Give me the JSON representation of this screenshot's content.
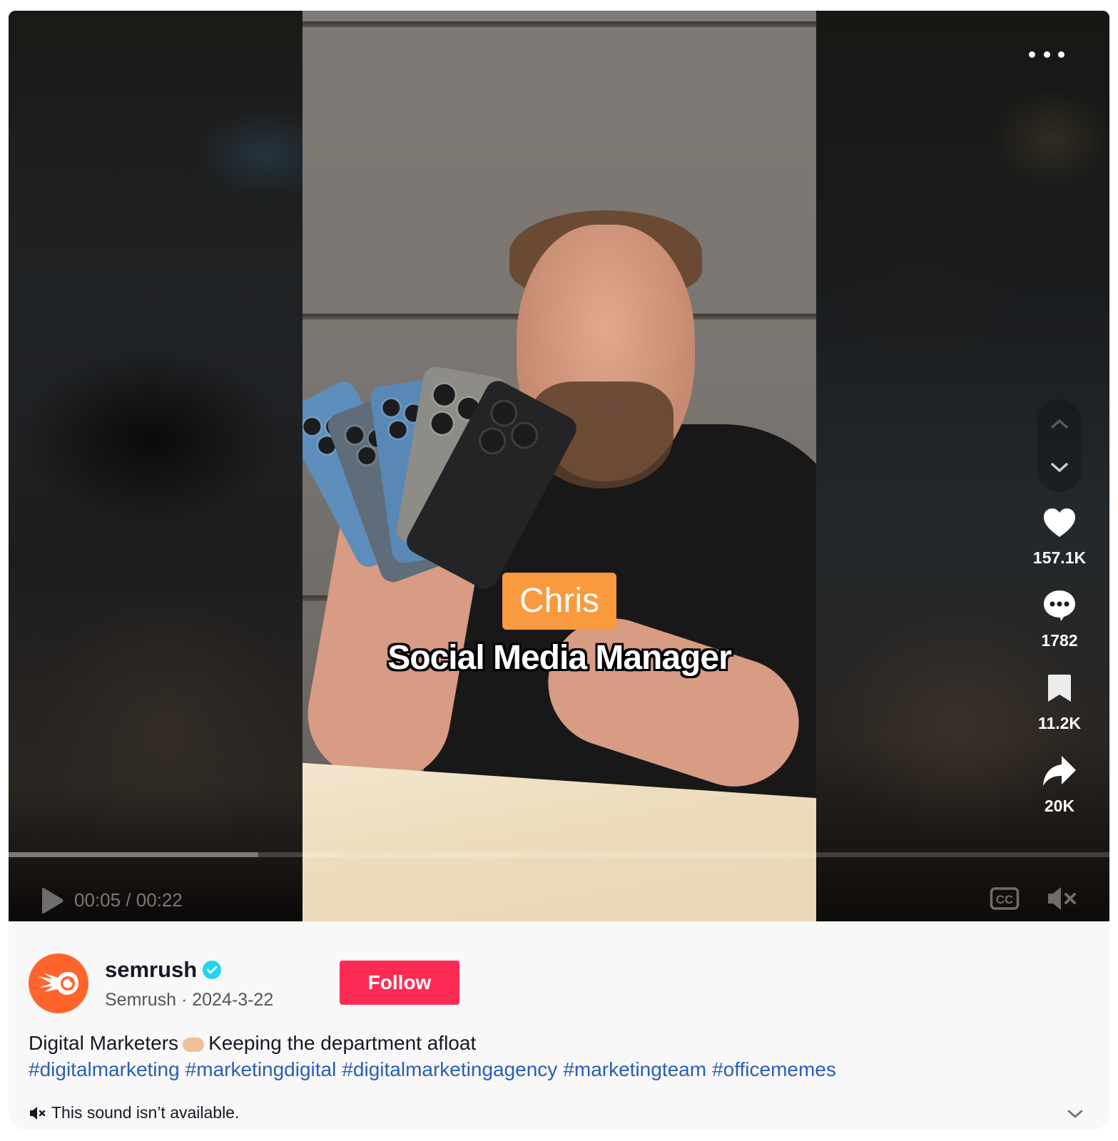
{
  "video": {
    "overlay_name": "Chris",
    "overlay_subtitle": "Social Media Manager",
    "current_time": "00:05",
    "duration": "00:22",
    "time_label": "00:05 / 00:22",
    "progress_fraction": 0.227
  },
  "icons": {
    "more": "more-horizontal-icon",
    "nav_up": "chevron-up-icon",
    "nav_down": "chevron-down-icon",
    "like": "heart-icon",
    "comment": "comment-icon",
    "save": "bookmark-icon",
    "share": "share-arrow-icon",
    "play": "play-icon",
    "captions": "closed-captions-icon",
    "mute": "volume-muted-icon",
    "expand": "chevron-down-icon"
  },
  "actions": {
    "likes": "157.1K",
    "comments": "1782",
    "saves": "11.2K",
    "shares": "20K"
  },
  "author": {
    "username": "semrush",
    "display_name": "Semrush",
    "date": "2024-3-22",
    "meta": "Semrush · 2024-3-22",
    "verified": true
  },
  "follow_label": "Follow",
  "description": {
    "text_before": "Digital Marketers",
    "emoji": "handshake",
    "text_after": "Keeping the department afloat",
    "hashtags": [
      "#digitalmarketing",
      "#marketingdigital",
      "#digitalmarketingagency",
      "#marketingteam",
      "#officememes"
    ]
  },
  "sound_text": "This sound isn’t available.",
  "colors": {
    "follow": "#fe2c55",
    "hashtag": "#2b5db9",
    "verified": "#20d5ec",
    "avatar": "#ff642d",
    "name_tag": "#fa9a3e"
  }
}
